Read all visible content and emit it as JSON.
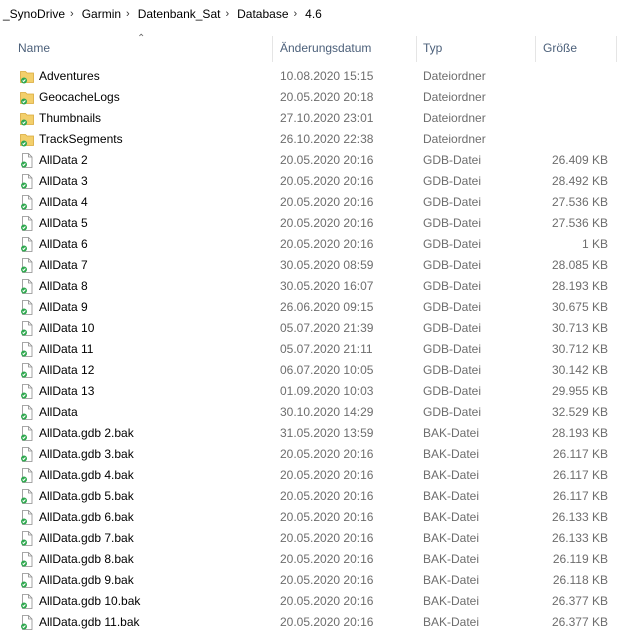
{
  "breadcrumb": [
    "_SynoDrive",
    "Garmin",
    "Datenbank_Sat",
    "Database",
    "4.6"
  ],
  "columns": {
    "name": "Name",
    "date": "Änderungsdatum",
    "type": "Typ",
    "size": "Größe"
  },
  "colors": {
    "folder": "#f3cf6b",
    "file": "#ffffff",
    "check": "#2fa84f",
    "header_text": "#4c607a",
    "meta_text": "#6d6d6d"
  },
  "files": [
    {
      "name": "Adventures",
      "date": "10.08.2020 15:15",
      "type": "Dateiordner",
      "size": "",
      "kind": "folder"
    },
    {
      "name": "GeocacheLogs",
      "date": "20.05.2020 20:18",
      "type": "Dateiordner",
      "size": "",
      "kind": "folder"
    },
    {
      "name": "Thumbnails",
      "date": "27.10.2020 23:01",
      "type": "Dateiordner",
      "size": "",
      "kind": "folder"
    },
    {
      "name": "TrackSegments",
      "date": "26.10.2020 22:38",
      "type": "Dateiordner",
      "size": "",
      "kind": "folder"
    },
    {
      "name": "AllData 2",
      "date": "20.05.2020 20:16",
      "type": "GDB-Datei",
      "size": "26.409 KB",
      "kind": "file"
    },
    {
      "name": "AllData 3",
      "date": "20.05.2020 20:16",
      "type": "GDB-Datei",
      "size": "28.492 KB",
      "kind": "file"
    },
    {
      "name": "AllData 4",
      "date": "20.05.2020 20:16",
      "type": "GDB-Datei",
      "size": "27.536 KB",
      "kind": "file"
    },
    {
      "name": "AllData 5",
      "date": "20.05.2020 20:16",
      "type": "GDB-Datei",
      "size": "27.536 KB",
      "kind": "file"
    },
    {
      "name": "AllData 6",
      "date": "20.05.2020 20:16",
      "type": "GDB-Datei",
      "size": "1 KB",
      "kind": "file"
    },
    {
      "name": "AllData 7",
      "date": "30.05.2020 08:59",
      "type": "GDB-Datei",
      "size": "28.085 KB",
      "kind": "file"
    },
    {
      "name": "AllData 8",
      "date": "30.05.2020 16:07",
      "type": "GDB-Datei",
      "size": "28.193 KB",
      "kind": "file"
    },
    {
      "name": "AllData 9",
      "date": "26.06.2020 09:15",
      "type": "GDB-Datei",
      "size": "30.675 KB",
      "kind": "file"
    },
    {
      "name": "AllData 10",
      "date": "05.07.2020 21:39",
      "type": "GDB-Datei",
      "size": "30.713 KB",
      "kind": "file"
    },
    {
      "name": "AllData 11",
      "date": "05.07.2020 21:11",
      "type": "GDB-Datei",
      "size": "30.712 KB",
      "kind": "file"
    },
    {
      "name": "AllData 12",
      "date": "06.07.2020 10:05",
      "type": "GDB-Datei",
      "size": "30.142 KB",
      "kind": "file"
    },
    {
      "name": "AllData 13",
      "date": "01.09.2020 10:03",
      "type": "GDB-Datei",
      "size": "29.955 KB",
      "kind": "file"
    },
    {
      "name": "AllData",
      "date": "30.10.2020 14:29",
      "type": "GDB-Datei",
      "size": "32.529 KB",
      "kind": "file"
    },
    {
      "name": "AllData.gdb 2.bak",
      "date": "31.05.2020 13:59",
      "type": "BAK-Datei",
      "size": "28.193 KB",
      "kind": "file"
    },
    {
      "name": "AllData.gdb 3.bak",
      "date": "20.05.2020 20:16",
      "type": "BAK-Datei",
      "size": "26.117 KB",
      "kind": "file"
    },
    {
      "name": "AllData.gdb 4.bak",
      "date": "20.05.2020 20:16",
      "type": "BAK-Datei",
      "size": "26.117 KB",
      "kind": "file"
    },
    {
      "name": "AllData.gdb 5.bak",
      "date": "20.05.2020 20:16",
      "type": "BAK-Datei",
      "size": "26.117 KB",
      "kind": "file"
    },
    {
      "name": "AllData.gdb 6.bak",
      "date": "20.05.2020 20:16",
      "type": "BAK-Datei",
      "size": "26.133 KB",
      "kind": "file"
    },
    {
      "name": "AllData.gdb 7.bak",
      "date": "20.05.2020 20:16",
      "type": "BAK-Datei",
      "size": "26.133 KB",
      "kind": "file"
    },
    {
      "name": "AllData.gdb 8.bak",
      "date": "20.05.2020 20:16",
      "type": "BAK-Datei",
      "size": "26.119 KB",
      "kind": "file"
    },
    {
      "name": "AllData.gdb 9.bak",
      "date": "20.05.2020 20:16",
      "type": "BAK-Datei",
      "size": "26.118 KB",
      "kind": "file"
    },
    {
      "name": "AllData.gdb 10.bak",
      "date": "20.05.2020 20:16",
      "type": "BAK-Datei",
      "size": "26.377 KB",
      "kind": "file"
    },
    {
      "name": "AllData.gdb 11.bak",
      "date": "20.05.2020 20:16",
      "type": "BAK-Datei",
      "size": "26.377 KB",
      "kind": "file"
    }
  ]
}
